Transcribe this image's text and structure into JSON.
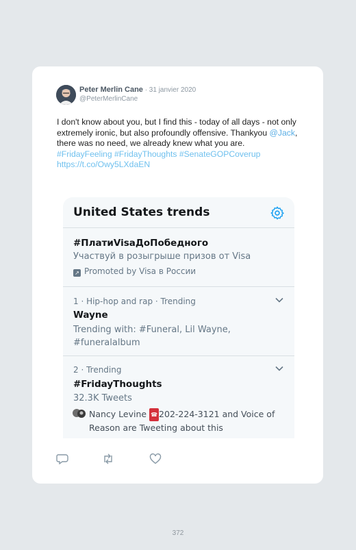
{
  "tweet": {
    "author_name": "Peter Merlin Cane",
    "date": " · 31 janvier 2020",
    "handle": "@PeterMerlinCane",
    "text_before_mention": "I don't know about you, but I find this - today of all days - not only extremely ironic, but also profoundly offensive. Thankyou ",
    "mention": "@Jack",
    "text_after_mention": ", there was no need, we already knew what you are.",
    "hashtags": "#FridayFeeling #FridayThoughts #SenateGOPCoverup",
    "link": "https://t.co/Owy5LXdaEN"
  },
  "trends_panel": {
    "title": "United States trends",
    "items": [
      {
        "name": "#ПлатиVisaДоПобедного",
        "subtitle": "Участвуй в розыгрыше призов от Visa",
        "promoted": "Promoted by Visa в России"
      },
      {
        "meta": "1 · Hip-hop and rap · Trending",
        "name": "Wayne",
        "subtitle": "Trending with: #Funeral, Lil Wayne, #funeralalbum"
      },
      {
        "meta": "2 · Trending",
        "name": "#FridayThoughts",
        "subtitle": "32.3K Tweets",
        "tweeting_name": "Nancy Levine ",
        "tweeting_phone_badge": "☎",
        "tweeting_rest": "202-224-3121 and Voice of Reason are Tweeting about this"
      }
    ]
  },
  "actions": {
    "reply_icon": "reply-icon",
    "retweet_icon": "retweet-icon",
    "like_icon": "heart-icon"
  },
  "page_number": "372",
  "colors": {
    "background": "#e4e8eb",
    "link": "#6fc0ee",
    "settings_accent": "#1da1f2"
  }
}
